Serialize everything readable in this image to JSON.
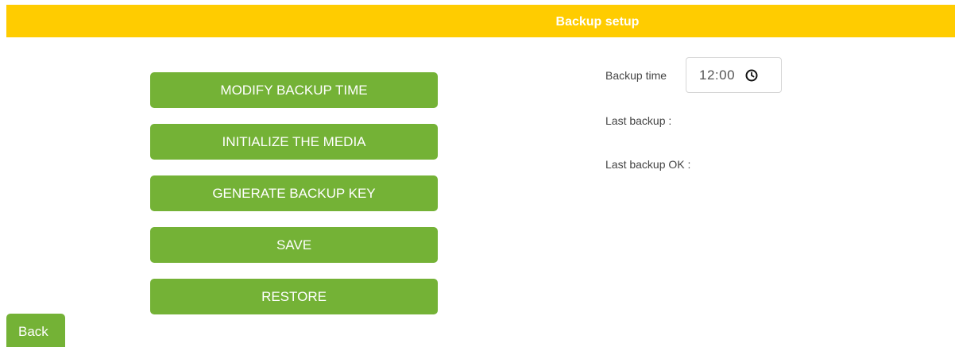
{
  "header": {
    "title": "Backup setup",
    "background_color": "#ffcc00"
  },
  "actions": {
    "modify_backup_time": "MODIFY BACKUP TIME",
    "initialize_media": "INITIALIZE THE MEDIA",
    "generate_backup_key": "GENERATE BACKUP KEY",
    "save": "SAVE",
    "restore": "RESTORE",
    "button_color": "#74b236"
  },
  "info": {
    "backup_time_label": "Backup time",
    "backup_time_value": "12:00",
    "backup_time_icon": "clock-icon",
    "last_backup_label": "Last backup :",
    "last_backup_ok_label": "Last backup OK :"
  },
  "footer": {
    "back_label": "Back"
  }
}
